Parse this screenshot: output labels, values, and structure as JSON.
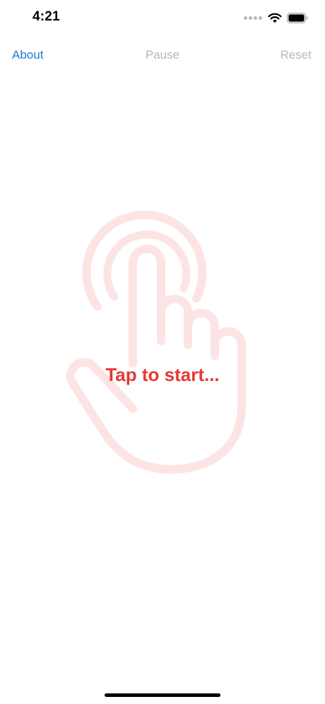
{
  "status_bar": {
    "time": "4:21",
    "icons": [
      "cellular-signal-icon",
      "wifi-icon",
      "battery-icon"
    ]
  },
  "nav": {
    "about_label": "About",
    "pause_label": "Pause",
    "reset_label": "Reset"
  },
  "main": {
    "prompt": "Tap to start...",
    "background_icon": "tap-hand-icon"
  },
  "colors": {
    "accent_blue": "#1a7fd4",
    "disabled_gray": "#b8b8b8",
    "prompt_red": "#e53935",
    "hand_outline": "#fde4e4",
    "status_text": "#000000"
  }
}
